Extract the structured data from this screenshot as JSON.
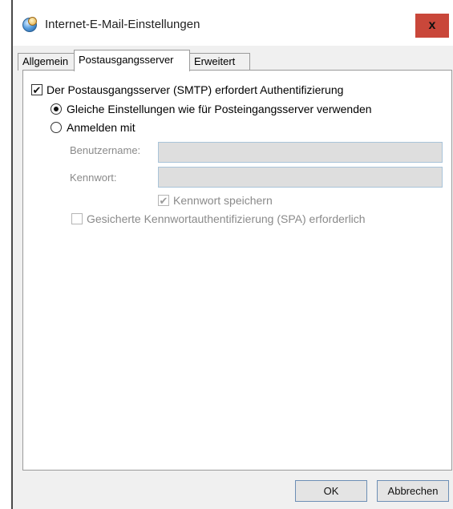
{
  "window": {
    "title": "Internet-E-Mail-Einstellungen",
    "close_label": "x"
  },
  "tabs": [
    {
      "label": "Allgemein"
    },
    {
      "label": "Postausgangsserver"
    },
    {
      "label": "Erweitert"
    }
  ],
  "smtp_auth": {
    "label": "Der Postausgangsserver (SMTP) erfordert Authentifizierung",
    "checked": true,
    "check_glyph": "✔"
  },
  "options": {
    "same_settings": {
      "label": "Gleiche Einstellungen wie für Posteingangsserver verwenden",
      "selected": true
    },
    "login_with": {
      "label": "Anmelden mit",
      "selected": false
    }
  },
  "fields": {
    "username": {
      "label": "Benutzername:",
      "value": ""
    },
    "password": {
      "label": "Kennwort:",
      "value": ""
    }
  },
  "save_password": {
    "label": "Kennwort speichern",
    "checked": true,
    "check_glyph": "✔"
  },
  "spa": {
    "label": "Gesicherte Kennwortauthentifizierung (SPA) erforderlich",
    "checked": false
  },
  "buttons": {
    "ok": "OK",
    "cancel": "Abbrechen"
  }
}
